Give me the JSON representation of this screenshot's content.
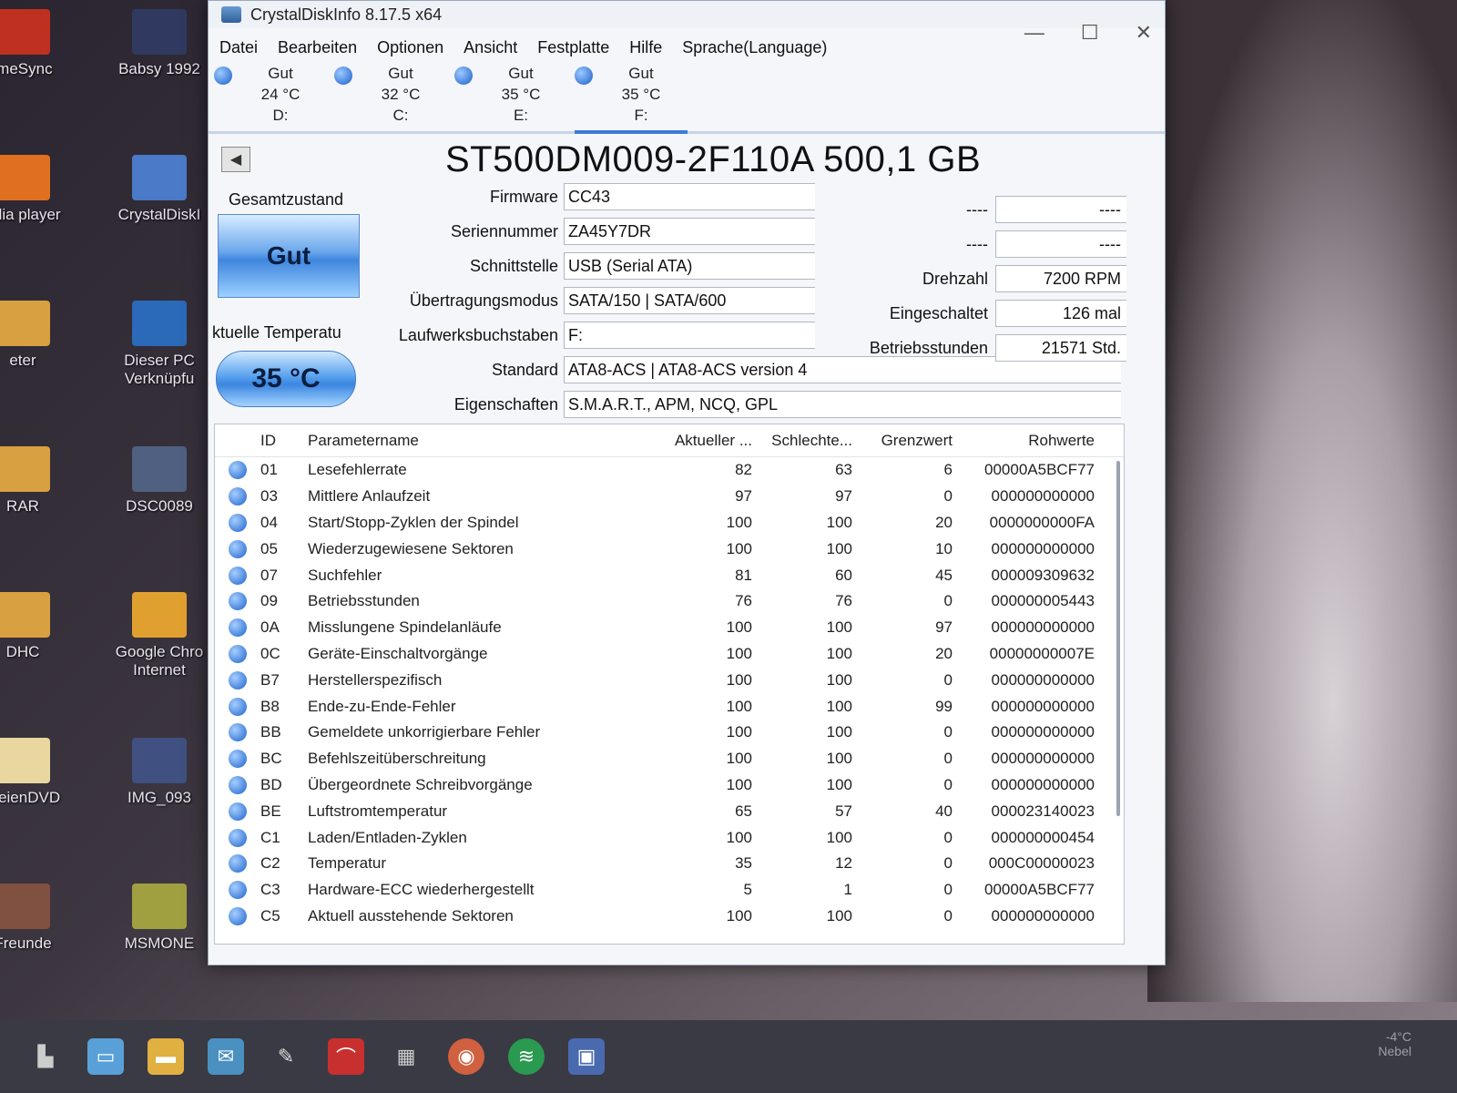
{
  "desktop_left": [
    {
      "label": "imeSync"
    },
    {
      "label": "edia player"
    },
    {
      "label": "eter"
    },
    {
      "label": "RAR"
    },
    {
      "label": "DHC"
    },
    {
      "label": "ateienDVD"
    },
    {
      "label": "Freunde"
    }
  ],
  "desktop_col2": [
    {
      "label": "Babsy 1992"
    },
    {
      "label": "CrystalDiskI"
    },
    {
      "label": "Dieser PC Verknüpfu"
    },
    {
      "label": "DSC0089"
    },
    {
      "label": "Google Chro Internet"
    },
    {
      "label": "IMG_093"
    },
    {
      "label": "MSMONE"
    }
  ],
  "window": {
    "title": "CrystalDiskInfo 8.17.5 x64",
    "controls": {
      "minimize": "—",
      "maximize": "☐",
      "close": "✕"
    }
  },
  "menu": [
    "Datei",
    "Bearbeiten",
    "Optionen",
    "Ansicht",
    "Festplatte",
    "Hilfe",
    "Sprache(Language)"
  ],
  "drives": [
    {
      "status": "Gut",
      "temp": "24 °C",
      "letter": "D:"
    },
    {
      "status": "Gut",
      "temp": "32 °C",
      "letter": "C:"
    },
    {
      "status": "Gut",
      "temp": "35 °C",
      "letter": "E:"
    },
    {
      "status": "Gut",
      "temp": "35 °C",
      "letter": "F:"
    }
  ],
  "disk": {
    "model": "ST500DM009-2F110A 500,1 GB",
    "health_label": "Gesamtzustand",
    "health": "Gut",
    "temp_label": "ktuelle Temperatu",
    "temp": "35 °C",
    "fields": [
      {
        "label": "Firmware",
        "value": "CC43"
      },
      {
        "label": "Seriennummer",
        "value": "ZA45Y7DR"
      },
      {
        "label": "Schnittstelle",
        "value": "USB (Serial ATA)"
      },
      {
        "label": "Übertragungsmodus",
        "value": "SATA/150 | SATA/600"
      },
      {
        "label": "Laufwerksbuchstaben",
        "value": "F:"
      },
      {
        "label": "Standard",
        "value": "ATA8-ACS | ATA8-ACS version 4"
      },
      {
        "label": "Eigenschaften",
        "value": "S.M.A.R.T., APM, NCQ, GPL"
      }
    ],
    "right_fields": [
      {
        "label": "----",
        "value": "----"
      },
      {
        "label": "----",
        "value": "----"
      },
      {
        "label": "Drehzahl",
        "value": "7200 RPM"
      },
      {
        "label": "Eingeschaltet",
        "value": "126 mal"
      },
      {
        "label": "Betriebsstunden",
        "value": "21571 Std."
      }
    ]
  },
  "smart": {
    "headers": {
      "id": "ID",
      "name": "Parametername",
      "current": "Aktueller ...",
      "worst": "Schlechte...",
      "threshold": "Grenzwert",
      "raw": "Rohwerte"
    },
    "rows": [
      {
        "id": "01",
        "name": "Lesefehlerrate",
        "current": "82",
        "worst": "63",
        "threshold": "6",
        "raw": "00000A5BCF77"
      },
      {
        "id": "03",
        "name": "Mittlere Anlaufzeit",
        "current": "97",
        "worst": "97",
        "threshold": "0",
        "raw": "000000000000"
      },
      {
        "id": "04",
        "name": "Start/Stopp-Zyklen der Spindel",
        "current": "100",
        "worst": "100",
        "threshold": "20",
        "raw": "0000000000FA"
      },
      {
        "id": "05",
        "name": "Wiederzugewiesene Sektoren",
        "current": "100",
        "worst": "100",
        "threshold": "10",
        "raw": "000000000000"
      },
      {
        "id": "07",
        "name": "Suchfehler",
        "current": "81",
        "worst": "60",
        "threshold": "45",
        "raw": "000009309632"
      },
      {
        "id": "09",
        "name": "Betriebsstunden",
        "current": "76",
        "worst": "76",
        "threshold": "0",
        "raw": "000000005443"
      },
      {
        "id": "0A",
        "name": "Misslungene Spindelanläufe",
        "current": "100",
        "worst": "100",
        "threshold": "97",
        "raw": "000000000000"
      },
      {
        "id": "0C",
        "name": "Geräte-Einschaltvorgänge",
        "current": "100",
        "worst": "100",
        "threshold": "20",
        "raw": "00000000007E"
      },
      {
        "id": "B7",
        "name": "Herstellerspezifisch",
        "current": "100",
        "worst": "100",
        "threshold": "0",
        "raw": "000000000000"
      },
      {
        "id": "B8",
        "name": "Ende-zu-Ende-Fehler",
        "current": "100",
        "worst": "100",
        "threshold": "99",
        "raw": "000000000000"
      },
      {
        "id": "BB",
        "name": "Gemeldete unkorrigierbare Fehler",
        "current": "100",
        "worst": "100",
        "threshold": "0",
        "raw": "000000000000"
      },
      {
        "id": "BC",
        "name": "Befehlszeitüberschreitung",
        "current": "100",
        "worst": "100",
        "threshold": "0",
        "raw": "000000000000"
      },
      {
        "id": "BD",
        "name": "Übergeordnete Schreibvorgänge",
        "current": "100",
        "worst": "100",
        "threshold": "0",
        "raw": "000000000000"
      },
      {
        "id": "BE",
        "name": "Luftstromtemperatur",
        "current": "65",
        "worst": "57",
        "threshold": "40",
        "raw": "000023140023"
      },
      {
        "id": "C1",
        "name": "Laden/Entladen-Zyklen",
        "current": "100",
        "worst": "100",
        "threshold": "0",
        "raw": "000000000454"
      },
      {
        "id": "C2",
        "name": "Temperatur",
        "current": "35",
        "worst": "12",
        "threshold": "0",
        "raw": "000C00000023"
      },
      {
        "id": "C3",
        "name": "Hardware-ECC wiederhergestellt",
        "current": "5",
        "worst": "1",
        "threshold": "0",
        "raw": "00000A5BCF77"
      },
      {
        "id": "C5",
        "name": "Aktuell ausstehende Sektoren",
        "current": "100",
        "worst": "100",
        "threshold": "0",
        "raw": "000000000000"
      }
    ]
  },
  "tray": {
    "temp": "-4°C",
    "weather": "Nebel"
  }
}
